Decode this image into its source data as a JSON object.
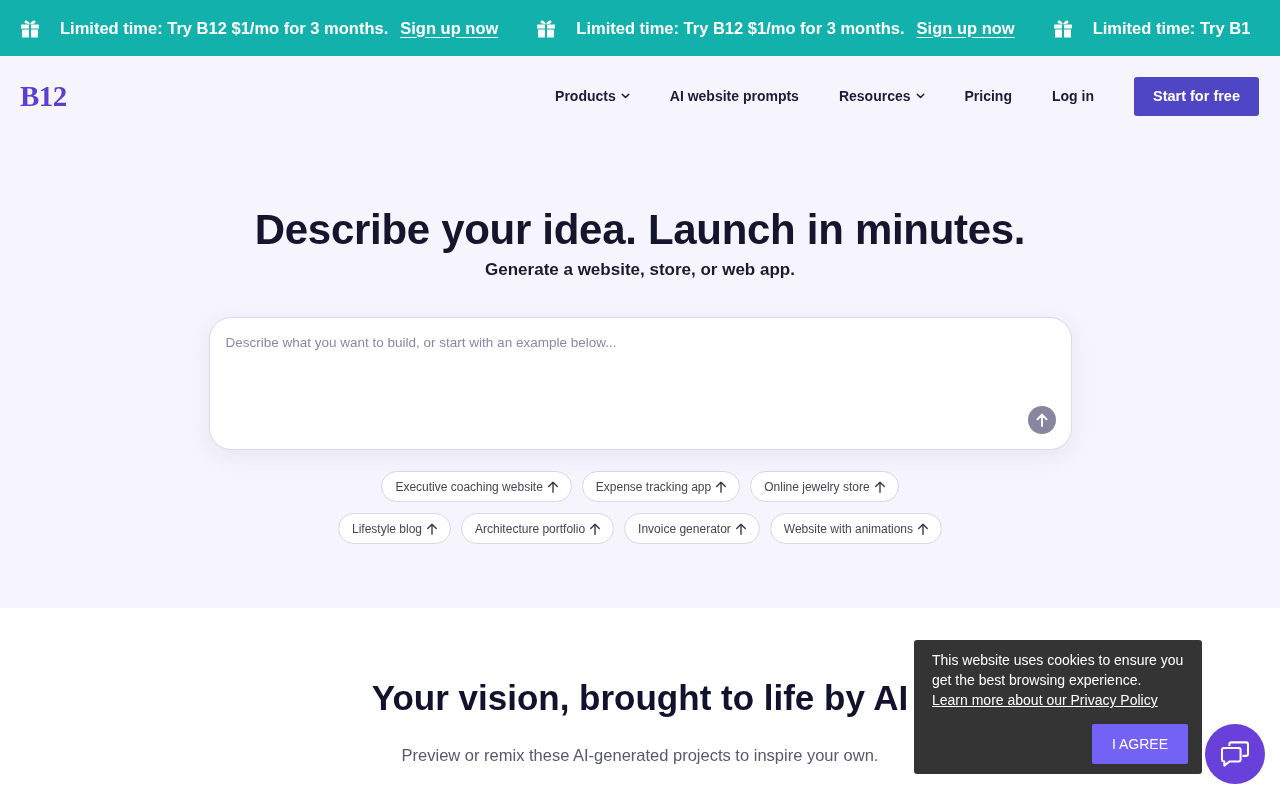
{
  "promo_banner": {
    "items": [
      {
        "message": "Limited time: Try B12 $1/mo for 3 months.",
        "link": "Sign up now"
      },
      {
        "message": "Limited time: Try B12 $1/mo for 3 months.",
        "link": "Sign up now"
      },
      {
        "message": "Limited time: Try B1"
      }
    ]
  },
  "nav": {
    "logo": "B12",
    "items": [
      {
        "label": "Products",
        "dropdown": true
      },
      {
        "label": "AI website prompts",
        "dropdown": false
      },
      {
        "label": "Resources",
        "dropdown": true
      },
      {
        "label": "Pricing",
        "dropdown": false
      },
      {
        "label": "Log in",
        "dropdown": false
      }
    ],
    "cta": "Start for free"
  },
  "hero": {
    "title": "Describe your idea. Launch in minutes.",
    "subtitle": "Generate a website, store, or web app.",
    "prompt": {
      "placeholder": "Describe what you want to build, or start with an example below..."
    },
    "example_rows": [
      [
        "Executive coaching website",
        "Expense tracking app",
        "Online jewelry store"
      ],
      [
        "Lifestyle blog",
        "Architecture portfolio",
        "Invoice generator",
        "Website with animations"
      ]
    ]
  },
  "showcase": {
    "title": "Your vision, brought to life by AI",
    "description": "Preview or remix these AI-generated projects to inspire your own."
  },
  "cookie_notice": {
    "message": "This website uses cookies to ensure you get the best browsing experience.",
    "link": "Learn more about our Privacy Policy",
    "button": "I AGREE"
  }
}
